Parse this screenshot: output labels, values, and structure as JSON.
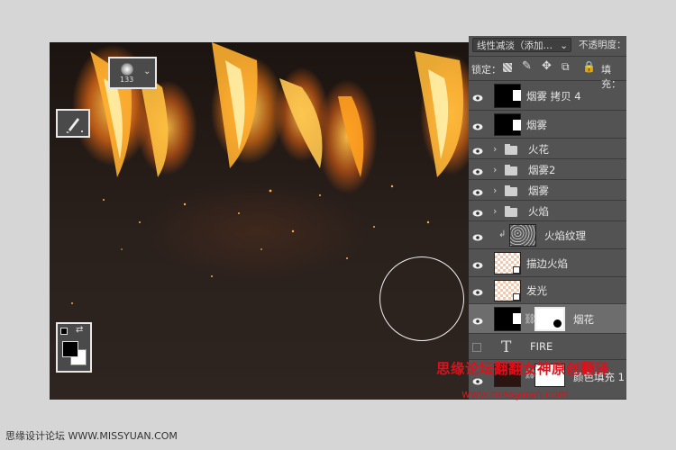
{
  "canvas": {
    "brush_size": "133"
  },
  "panel": {
    "blend_mode": "线性减淡（添加…",
    "opacity_label": "不透明度：",
    "lock_label": "锁定：",
    "fill_label": "填充："
  },
  "layers": [
    {
      "name": "烟雾 拷贝 4",
      "visible": true,
      "type": "masked"
    },
    {
      "name": "烟雾",
      "visible": true,
      "type": "masked"
    },
    {
      "name": "火花",
      "visible": true,
      "type": "group"
    },
    {
      "name": "烟雾2",
      "visible": true,
      "type": "group"
    },
    {
      "name": "烟雾",
      "visible": true,
      "type": "group"
    },
    {
      "name": "火焰",
      "visible": true,
      "type": "group"
    },
    {
      "name": "火焰纹理",
      "visible": true,
      "type": "clipped"
    },
    {
      "name": "描边火焰",
      "visible": true,
      "type": "smart"
    },
    {
      "name": "发光",
      "visible": true,
      "type": "smart"
    },
    {
      "name": "烟花",
      "visible": true,
      "type": "masked",
      "selected": true
    },
    {
      "name": "FIRE",
      "visible": false,
      "type": "text"
    },
    {
      "name": "颜色填充 1",
      "visible": true,
      "type": "fill"
    }
  ],
  "watermark": {
    "line1": "思缘论坛翻翻女神原创翻译",
    "line2": "www.missyuan.com"
  },
  "footer": "思缘设计论坛 WWW.MISSYUAN.COM",
  "colors": {
    "selected_row": "#6d6d6d",
    "panel_bg": "#535353",
    "watermark": "#e0101a"
  }
}
